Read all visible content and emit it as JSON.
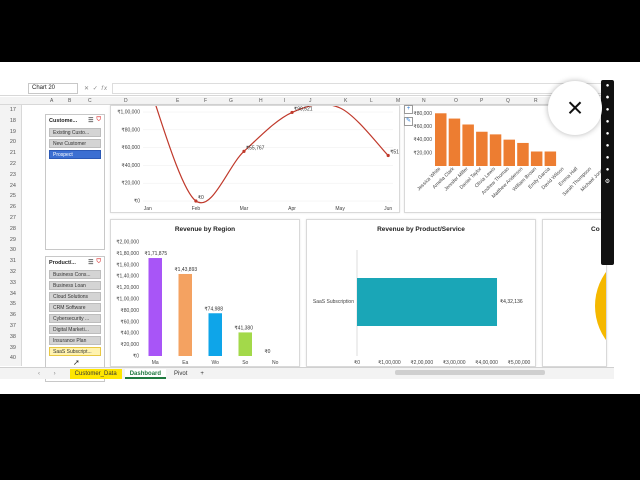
{
  "formula_bar": {
    "name_box": "Chart 20",
    "fx": "fx"
  },
  "columns": [
    "A",
    "B",
    "C",
    "D",
    "E",
    "F",
    "G",
    "H",
    "I",
    "J",
    "K",
    "L",
    "M",
    "N",
    "O",
    "P",
    "Q",
    "R",
    "S"
  ],
  "rows": [
    "17",
    "18",
    "19",
    "20",
    "21",
    "22",
    "23",
    "24",
    "25",
    "26",
    "27",
    "28",
    "29",
    "30",
    "31",
    "32",
    "33",
    "34",
    "35",
    "36",
    "37",
    "38",
    "39",
    "40"
  ],
  "slicer_customer": {
    "title": "Custome...",
    "items": [
      "Existing Custo...",
      "New Customer",
      "Prospect"
    ],
    "selected": "Prospect"
  },
  "slicer_product": {
    "title": "Product/...",
    "items": [
      "Business Cons...",
      "Business Loan",
      "Cloud Solutions",
      "CRM Software",
      "Cybersecurity ...",
      "Digital Marketi...",
      "Insurance Plan",
      "SaaS Subscript..."
    ],
    "selected": "SaaS Subscript..."
  },
  "chart_data": [
    {
      "type": "line",
      "x": [
        "Jan",
        "Feb",
        "Mar",
        "Apr",
        "May",
        "Jun"
      ],
      "y_ticks": [
        "₹0",
        "₹20,000",
        "₹40,000",
        "₹60,000",
        "₹80,000",
        "₹1,00,000"
      ],
      "ylim": [
        0,
        100000
      ],
      "series": [
        {
          "values": [
            null,
            0,
            55767,
            99521,
            null,
            51125
          ],
          "labels": [
            "",
            "₹0",
            "₹55,767",
            "₹99,521",
            "",
            "₹51,125"
          ]
        }
      ],
      "color": "#c0392b"
    },
    {
      "type": "bar",
      "categories": [
        "Jessica White",
        "Amelia Clark",
        "Jennifer Miller",
        "Daniel Taylor",
        "Olivia Lewis",
        "Andrew Thomas",
        "Matthew Anderson",
        "William Brown",
        "Emily Garcia",
        "David Wilson",
        "Emma Hall",
        "Sarah Thompson",
        "Michael Jones"
      ],
      "values": [
        80000,
        72000,
        63000,
        52000,
        48000,
        40000,
        35000,
        22000,
        22000,
        null,
        null,
        null,
        null
      ],
      "y_ticks": [
        "₹20,000",
        "₹40,000",
        "₹60,000",
        "₹80,000"
      ],
      "ylim": [
        0,
        85000
      ],
      "color": "#ed7d31"
    },
    {
      "type": "bar",
      "title": "Revenue by Region",
      "categories": [
        "Ma",
        "Ea",
        "Wo",
        "So",
        "No"
      ],
      "values": [
        171875,
        143893,
        74988,
        41380,
        0
      ],
      "labels": [
        "₹1,71,875",
        "₹1,43,893",
        "₹74,988",
        "₹41,380",
        "₹0"
      ],
      "y_ticks": [
        "₹0",
        "₹20,000",
        "₹40,000",
        "₹60,000",
        "₹80,000",
        "₹1,00,000",
        "₹1,20,000",
        "₹1,40,000",
        "₹1,60,000",
        "₹1,80,000",
        "₹2,00,000"
      ],
      "ylim": [
        0,
        200000
      ],
      "colors": [
        "#a855f7",
        "#f4a261",
        "#0ea5e9",
        "#a3d94a",
        "#cccccc"
      ]
    },
    {
      "type": "bar",
      "title": "Revenue by Product/Service",
      "categories": [
        "SaaS Subscription"
      ],
      "values": [
        432136
      ],
      "labels": [
        "₹4,32,136"
      ],
      "x_ticks": [
        "₹0",
        "₹1,00,000",
        "₹2,00,000",
        "₹3,00,000",
        "₹4,00,000",
        "₹5,00,000"
      ],
      "color": "#1aa6b7"
    },
    {
      "type": "pie",
      "title": "Co",
      "color": "#f5b800"
    }
  ],
  "sheet_tabs": [
    "Customer_Data",
    "Dashboard",
    "Pivot"
  ],
  "active_tab": "Dashboard",
  "add_tab": "+",
  "close_label": "×",
  "right_strip_icons": [
    "●",
    "⏺",
    "●",
    "●",
    "●",
    "●",
    "●",
    "●",
    "⚙"
  ]
}
